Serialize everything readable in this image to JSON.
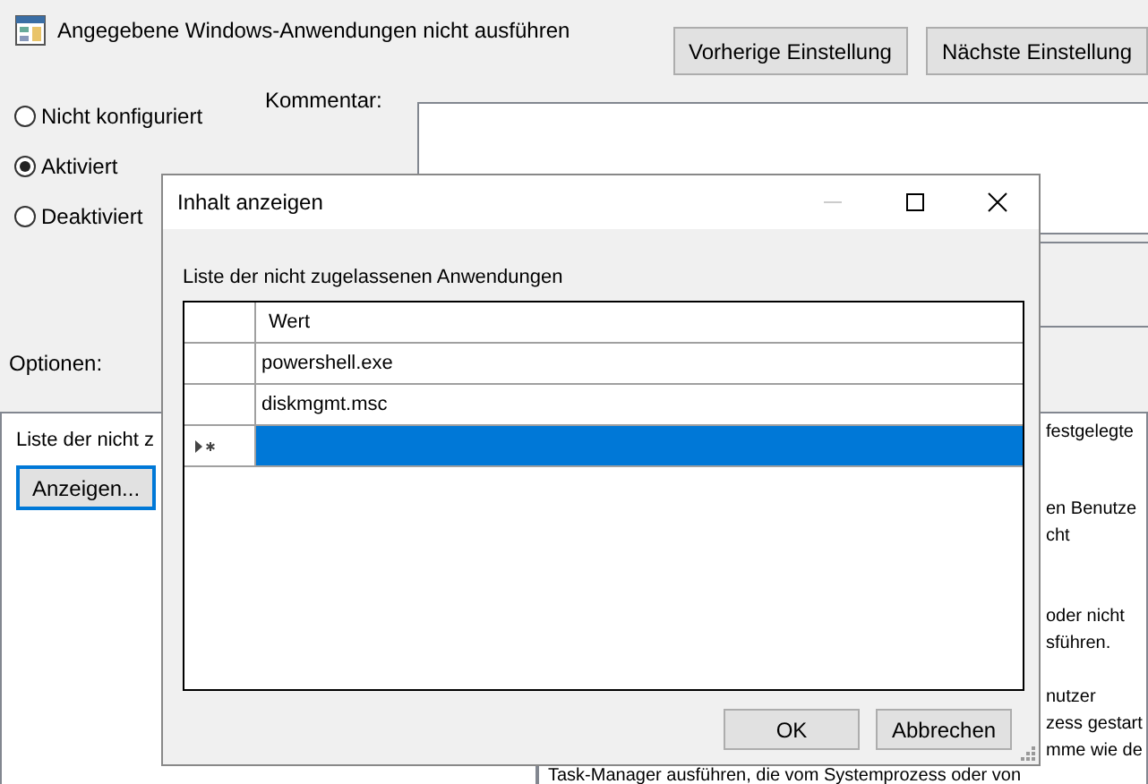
{
  "window": {
    "title": "Angegebene Windows-Anwendungen nicht ausführen"
  },
  "nav_buttons": [
    "Vorherige Einstellung",
    "Nächste Einstellung"
  ],
  "state_options": [
    {
      "label": "Nicht konfiguriert",
      "selected": false
    },
    {
      "label": "Aktiviert",
      "selected": true
    },
    {
      "label": "Deaktiviert",
      "selected": false
    }
  ],
  "comment": {
    "label": "Kommentar:"
  },
  "options": {
    "label": "Optionen:",
    "list_label": "Liste der nicht z",
    "button": {
      "label": "Anzeigen...",
      "focused": true
    }
  },
  "help": {
    "paragraphs": [
      [
        "festgelegte"
      ],
      [
        "en Benutze",
        "cht"
      ],
      [
        "oder nicht",
        "sführen."
      ],
      [
        "nutzer",
        "zess gestart",
        "mme wie de"
      ]
    ],
    "last_line": "Task-Manager ausführen, die vom Systemprozess oder von"
  },
  "dialog": {
    "title": "Inhalt anzeigen",
    "controls": [
      {
        "kind": "minimize",
        "disabled": true
      },
      {
        "kind": "maximize",
        "disabled": false
      },
      {
        "kind": "close",
        "disabled": false
      }
    ],
    "label": "Liste der nicht zugelassenen Anwendungen",
    "table": {
      "columns": [
        "Wert"
      ],
      "rows": [
        {
          "kind": "value",
          "value": "powershell.exe",
          "selected": false
        },
        {
          "kind": "value",
          "value": "diskmgmt.msc",
          "selected": false
        },
        {
          "kind": "new",
          "selected": true
        }
      ]
    },
    "buttons": [
      "OK",
      "Abbrechen"
    ]
  }
}
